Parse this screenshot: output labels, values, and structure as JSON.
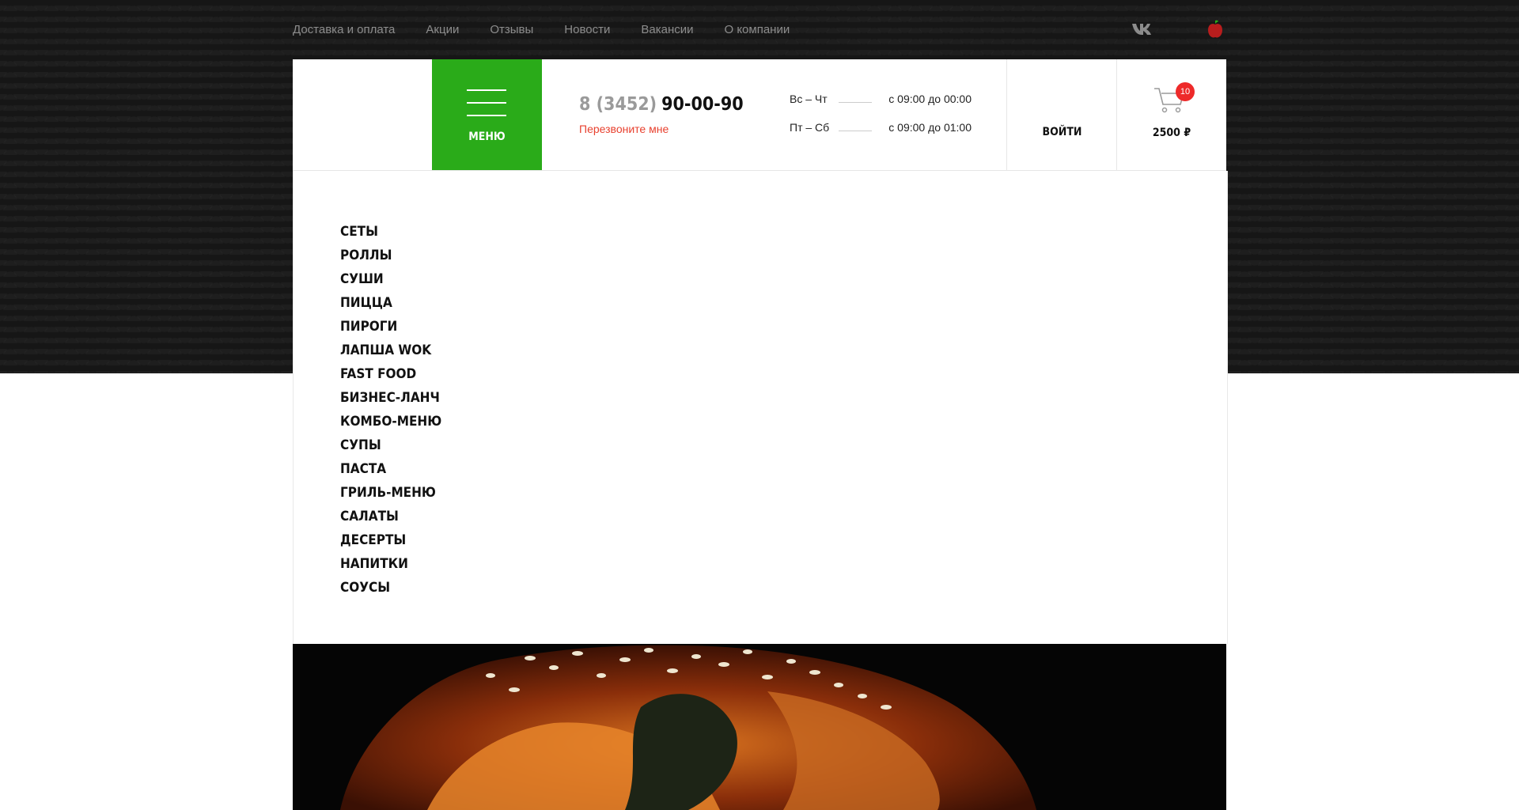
{
  "topnav": {
    "links": [
      "Доставка и оплата",
      "Акции",
      "Отзывы",
      "Новости",
      "Вакансии",
      "О компании"
    ]
  },
  "social": {
    "vk_icon": "vk-icon",
    "apple_icon": "apple-icon"
  },
  "header": {
    "menu_label": "МЕНЮ",
    "phone_code": "8 (3452)",
    "phone_number": "90-00-90",
    "callback": "Перезвоните мне",
    "hours": [
      {
        "days": "Вс – Чт",
        "time": "с 09:00 до 00:00"
      },
      {
        "days": "Пт – Сб",
        "time": "с 09:00 до 01:00"
      }
    ],
    "login": "ВОЙТИ",
    "cart_count": "10",
    "cart_total": "2500 ₽"
  },
  "menu": {
    "categories": [
      "Сеты",
      "Роллы",
      "Суши",
      "Пицца",
      "Пироги",
      "Лапша WOK",
      "Fast food",
      "Бизнес-ланч",
      "Комбо-меню",
      "Супы",
      "Паста",
      "Гриль-меню",
      "Салаты",
      "Десерты",
      "Напитки",
      "Соусы"
    ]
  },
  "colors": {
    "accent_green": "#2aab19",
    "callback_red": "#e8412f",
    "badge_red": "#ee2a2a",
    "dark_bg": "#161616"
  }
}
